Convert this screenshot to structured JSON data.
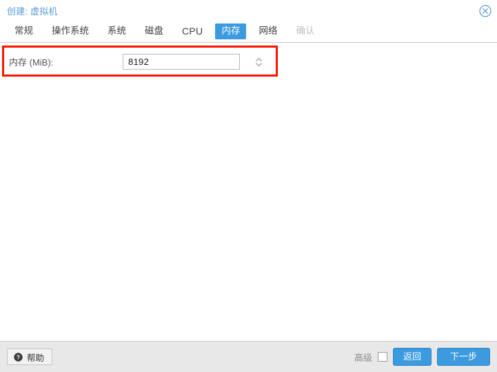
{
  "window": {
    "title": "创建: 虚拟机",
    "close_icon": "close-circle-icon"
  },
  "tabs": [
    {
      "label": "常规",
      "state": "normal"
    },
    {
      "label": "操作系统",
      "state": "normal"
    },
    {
      "label": "系统",
      "state": "normal"
    },
    {
      "label": "磁盘",
      "state": "normal"
    },
    {
      "label": "CPU",
      "state": "normal"
    },
    {
      "label": "内存",
      "state": "active"
    },
    {
      "label": "网络",
      "state": "normal"
    },
    {
      "label": "确认",
      "state": "disabled"
    }
  ],
  "form": {
    "memory": {
      "label": "内存 (MiB):",
      "value": "8192",
      "placeholder": "",
      "spinner_up_icon": "chevron-up-icon",
      "spinner_down_icon": "chevron-down-icon"
    },
    "highlight_color": "#fb1500"
  },
  "footer": {
    "help_label": "帮助",
    "help_icon": "question-mark-circle-icon",
    "advanced_label": "高级",
    "advanced_checked": false,
    "back_label": "返回",
    "next_label": "下一步"
  },
  "colors": {
    "accent": "#3c9ade",
    "title": "#5b9bd5",
    "highlight": "#fb1500",
    "footer_bg": "#e8e8e8",
    "disabled_text": "#c0c0c0"
  }
}
